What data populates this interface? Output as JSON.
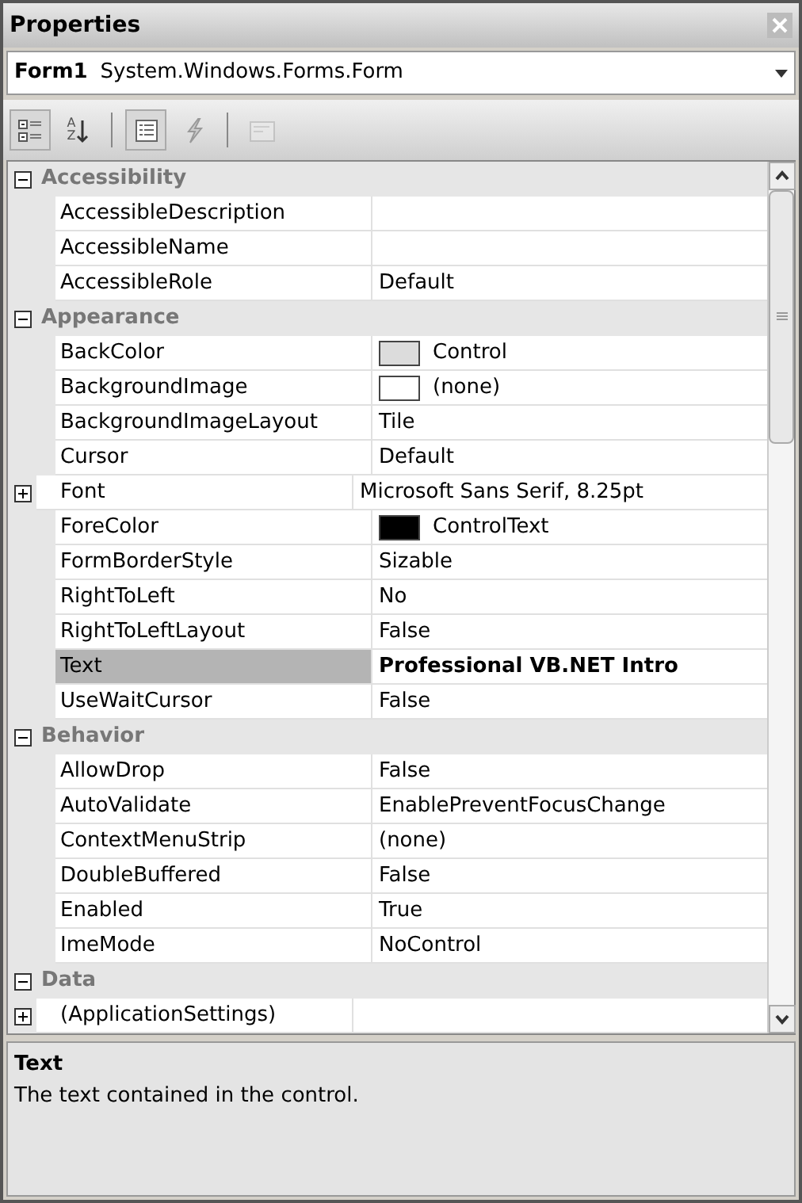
{
  "window": {
    "title": "Properties"
  },
  "object_selector": {
    "name": "Form1",
    "type": "System.Windows.Forms.Form"
  },
  "toolbar": [
    {
      "kind": "categorized",
      "selected": true,
      "disabled": false
    },
    {
      "kind": "alphabetical",
      "glyphs": [
        "A",
        "Z"
      ],
      "selected": false,
      "disabled": false
    },
    {
      "kind": "separator"
    },
    {
      "kind": "properties",
      "selected": true,
      "disabled": false
    },
    {
      "kind": "events",
      "selected": false,
      "disabled": false
    },
    {
      "kind": "separator"
    },
    {
      "kind": "property_pages",
      "selected": false,
      "disabled": true
    }
  ],
  "categories": [
    {
      "name": "Accessibility",
      "expanded": true,
      "properties": [
        {
          "name": "AccessibleDescription",
          "selected": false,
          "modified": false
        },
        {
          "name": "AccessibleName",
          "selected": false,
          "modified": false
        },
        {
          "name": "AccessibleRole",
          "value": "Default",
          "selected": false,
          "modified": false
        }
      ]
    },
    {
      "name": "Appearance",
      "expanded": true,
      "properties": [
        {
          "name": "BackColor",
          "value": "Control",
          "color": "#dcdcdc",
          "selected": false,
          "modified": false
        },
        {
          "name": "BackgroundImage",
          "value": "(none)",
          "color": "#ffffff",
          "selected": false,
          "modified": false
        },
        {
          "name": "BackgroundImageLayout",
          "value": "Tile",
          "selected": false,
          "modified": false
        },
        {
          "name": "Cursor",
          "value": "Default",
          "selected": false,
          "modified": false
        },
        {
          "name": "Font",
          "value": "Microsoft Sans Serif, 8.25pt",
          "expandable": true,
          "expanded": false,
          "selected": false,
          "modified": false
        },
        {
          "name": "ForeColor",
          "value": "ControlText",
          "color": "#000000",
          "selected": false,
          "modified": false
        },
        {
          "name": "FormBorderStyle",
          "value": "Sizable",
          "selected": false,
          "modified": false
        },
        {
          "name": "RightToLeft",
          "value": "No",
          "selected": false,
          "modified": false
        },
        {
          "name": "RightToLeftLayout",
          "value": "False",
          "selected": false,
          "modified": false
        },
        {
          "name": "Text",
          "value": "Professional VB.NET Intro",
          "selected": true,
          "modified": true
        },
        {
          "name": "UseWaitCursor",
          "value": "False",
          "selected": false,
          "modified": false
        }
      ]
    },
    {
      "name": "Behavior",
      "expanded": true,
      "properties": [
        {
          "name": "AllowDrop",
          "value": "False",
          "selected": false,
          "modified": false
        },
        {
          "name": "AutoValidate",
          "value": "EnablePreventFocusChange",
          "selected": false,
          "modified": false
        },
        {
          "name": "ContextMenuStrip",
          "value": "(none)",
          "selected": false,
          "modified": false
        },
        {
          "name": "DoubleBuffered",
          "value": "False",
          "selected": false,
          "modified": false
        },
        {
          "name": "Enabled",
          "value": "True",
          "selected": false,
          "modified": false
        },
        {
          "name": "ImeMode",
          "value": "NoControl",
          "selected": false,
          "modified": false
        }
      ]
    },
    {
      "name": "Data",
      "expanded": true,
      "properties": [
        {
          "name": "(ApplicationSettings)",
          "expandable": true,
          "expanded": false,
          "selected": false,
          "modified": false
        }
      ]
    }
  ],
  "description": {
    "title": "Text",
    "text": "The text contained in the control."
  }
}
